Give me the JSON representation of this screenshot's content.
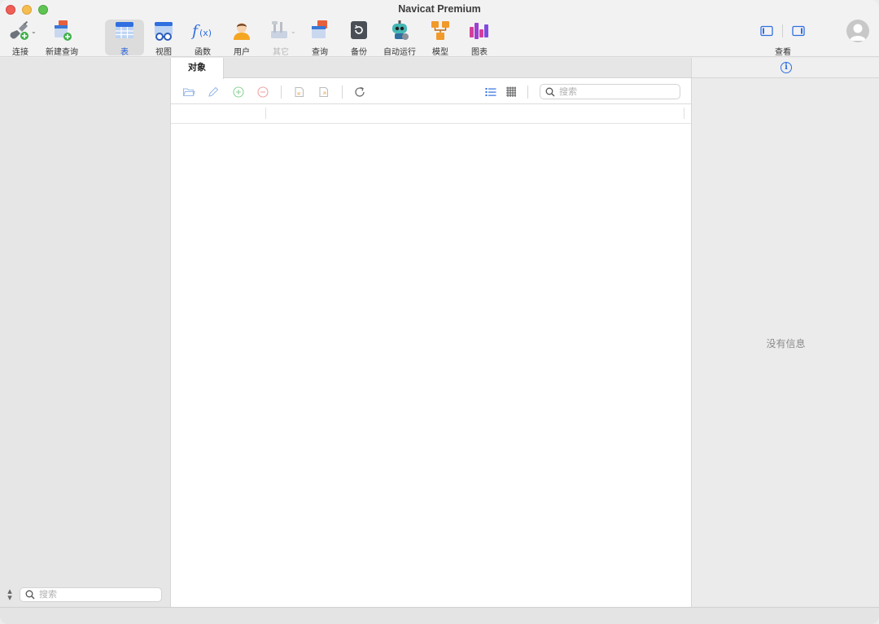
{
  "window": {
    "title": "Navicat Premium"
  },
  "toolbar": {
    "connect": "连接",
    "new_query": "新建查询",
    "table": "表",
    "view": "视图",
    "function": "函数",
    "user": "用户",
    "other": "其它",
    "query": "查询",
    "backup": "备份",
    "automation": "自动运行",
    "model": "模型",
    "chart": "图表",
    "view_toggle": "查看",
    "active_item": "表"
  },
  "main": {
    "tabs": [
      {
        "label": "对象",
        "active": true
      }
    ],
    "search_placeholder": "搜索"
  },
  "sidebar": {
    "search_placeholder": "搜索"
  },
  "info_panel": {
    "empty_text": "没有信息"
  },
  "colors": {
    "accent": "#1f5bd6",
    "info_blue": "#2f6fe0"
  }
}
